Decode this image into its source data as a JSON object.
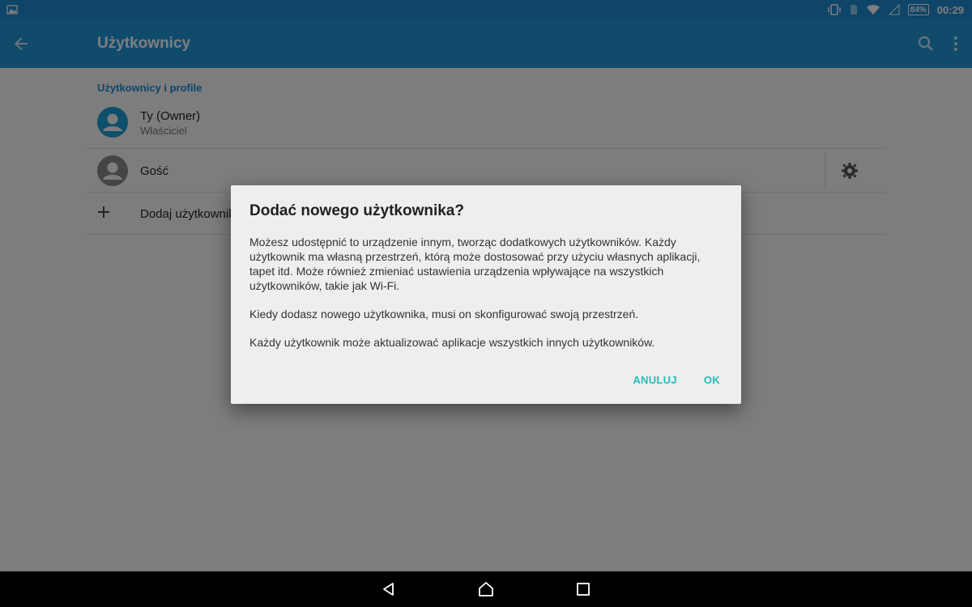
{
  "status_bar": {
    "notification_icon": "image-icon",
    "icons": [
      "vibrate-icon",
      "sim-icon",
      "wifi-icon",
      "signal-icon"
    ],
    "battery": "84%",
    "time": "00:29"
  },
  "app_bar": {
    "title": "Użytkownicy",
    "back_icon": "arrow-back-icon",
    "search_icon": "search-icon",
    "more_icon": "more-vert-icon",
    "color": "#2196d9"
  },
  "users": {
    "section_header": "Użytkownicy i profile",
    "owner": {
      "name": "Ty (Owner)",
      "role": "Właściciel"
    },
    "guest": {
      "name": "Gość"
    },
    "add_user": {
      "label": "Dodaj użytkownika"
    }
  },
  "dialog": {
    "title": "Dodać nowego użytkownika?",
    "paragraphs": [
      "Możesz udostępnić to urządzenie innym, tworząc dodatkowych użytkowników. Każdy użytkownik ma własną przestrzeń, którą może dostosować przy użyciu własnych aplikacji, tapet itd. Może również zmieniać ustawienia urządzenia wpływające na wszystkich użytkowników, takie jak Wi-Fi.",
      "Kiedy dodasz nowego użytkownika, musi on skonfigurować swoją przestrzeń.",
      "Każdy użytkownik może aktualizować aplikacje wszystkich innych użytkowników."
    ],
    "cancel_label": "ANULUJ",
    "ok_label": "OK",
    "accent_color": "#20c0b8"
  },
  "nav_bar": {
    "icons": [
      "nav-back-icon",
      "nav-home-icon",
      "nav-recent-icon"
    ]
  }
}
